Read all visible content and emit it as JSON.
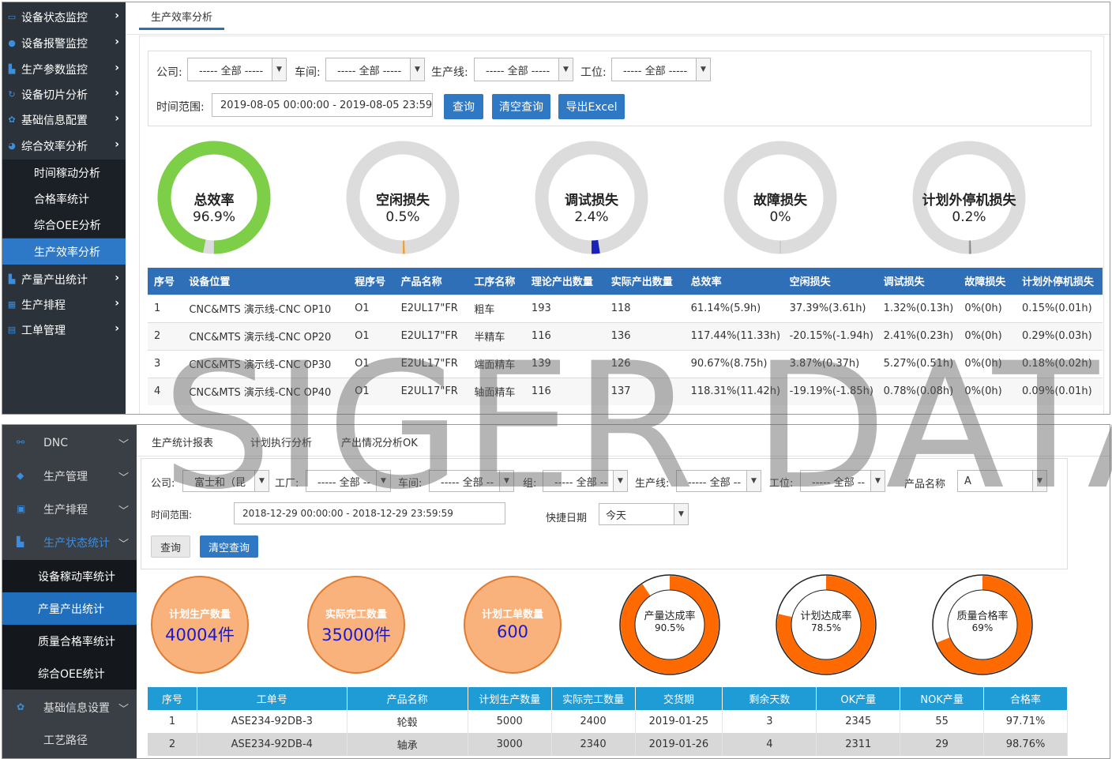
{
  "top": {
    "sidebar": {
      "items": [
        {
          "label": "设备状态监控",
          "icon": "monitor-icon"
        },
        {
          "label": "设备报警监控",
          "icon": "alarm-icon"
        },
        {
          "label": "生产参数监控",
          "icon": "chart-icon"
        },
        {
          "label": "设备切片分析",
          "icon": "refresh-icon"
        },
        {
          "label": "基础信息配置",
          "icon": "gear-icon"
        },
        {
          "label": "综合效率分析",
          "icon": "pie-icon"
        }
      ],
      "subitems": [
        "时间稼动分析",
        "合格率统计",
        "综合OEE分析",
        "生产效率分析"
      ],
      "active_sub": 3,
      "items_after": [
        {
          "label": "产量产出统计",
          "icon": "bar-chart-icon"
        },
        {
          "label": "生产排程",
          "icon": "calendar-icon"
        },
        {
          "label": "工单管理",
          "icon": "clipboard-icon"
        }
      ]
    },
    "tab": "生产效率分析",
    "filters": {
      "company_label": "公司:",
      "company_value": "----- 全部 -----",
      "workshop_label": "车间:",
      "workshop_value": "----- 全部 -----",
      "line_label": "生产线:",
      "line_value": "----- 全部 -----",
      "station_label": "工位:",
      "station_value": "----- 全部 -----",
      "time_label": "时间范围:",
      "time_value": "2019-08-05 00:00:00 - 2019-08-05 23:59:59",
      "query_btn": "查询",
      "clear_btn": "清空查询",
      "export_btn": "导出Excel"
    },
    "donuts": [
      {
        "label": "总效率",
        "value": "96.9%",
        "percent": 96.9,
        "color": "#7dcf47"
      },
      {
        "label": "空闲损失",
        "value": "0.5%",
        "percent": 0.5,
        "color": "#f0a030"
      },
      {
        "label": "调试损失",
        "value": "2.4%",
        "percent": 2.4,
        "color": "#1a23b8"
      },
      {
        "label": "故障损失",
        "value": "0%",
        "percent": 0,
        "color": "#888888"
      },
      {
        "label": "计划外停机损失",
        "value": "0.2%",
        "percent": 0.2,
        "color": "#888888"
      }
    ],
    "table": {
      "headers": [
        "序号",
        "设备位置",
        "程序号",
        "产品名称",
        "工序名称",
        "理论产出数量",
        "实际产出数量",
        "总效率",
        "空闲损失",
        "调试损失",
        "故障损失",
        "计划外停机损失"
      ],
      "rows": [
        [
          "1",
          "CNC&MTS 演示线-CNC OP10",
          "O1",
          "E2UL17\"FR",
          "粗车",
          "193",
          "118",
          "61.14%(5.9h)",
          "37.39%(3.61h)",
          "1.32%(0.13h)",
          "0%(0h)",
          "0.15%(0.01h)"
        ],
        [
          "2",
          "CNC&MTS 演示线-CNC OP20",
          "O1",
          "E2UL17\"FR",
          "半精车",
          "116",
          "136",
          "117.44%(11.33h)",
          "-20.15%(-1.94h)",
          "2.41%(0.23h)",
          "0%(0h)",
          "0.29%(0.03h)"
        ],
        [
          "3",
          "CNC&MTS 演示线-CNC OP30",
          "O1",
          "E2UL17\"FR",
          "端面精车",
          "139",
          "126",
          "90.67%(8.75h)",
          "3.87%(0.37h)",
          "5.27%(0.51h)",
          "0%(0h)",
          "0.18%(0.02h)"
        ],
        [
          "4",
          "CNC&MTS 演示线-CNC OP40",
          "O1",
          "E2UL17\"FR",
          "轴面精车",
          "116",
          "137",
          "118.31%(11.42h)",
          "-19.19%(-1.85h)",
          "0.78%(0.08h)",
          "0%(0h)",
          "0.09%(0.01h)"
        ]
      ]
    }
  },
  "bottom": {
    "sidebar": {
      "items": [
        {
          "label": "DNC",
          "icon": "dnc-icon"
        },
        {
          "label": "生产管理",
          "icon": "cube-icon"
        },
        {
          "label": "生产排程",
          "icon": "schedule-icon"
        },
        {
          "label": "生产状态统计",
          "icon": "stats-icon"
        }
      ],
      "subitems": [
        "设备稼动率统计",
        "产量产出统计",
        "质量合格率统计",
        "综合OEE统计"
      ],
      "active_sub": 1,
      "items_after": [
        {
          "label": "基础信息设置",
          "icon": "gear-icon"
        },
        {
          "label": "工艺路径",
          "icon": ""
        }
      ]
    },
    "tabs": [
      "生产统计报表",
      "计划执行分析",
      "产出情况分析OK"
    ],
    "filters": {
      "company_label": "公司:",
      "company_value": "富士和（昆",
      "factory_label": "工厂:",
      "factory_value": "----- 全部 --",
      "workshop_label": "车间:",
      "workshop_value": "----- 全部 --",
      "group_label": "组:",
      "group_value": "----- 全部 --",
      "line_label": "生产线:",
      "line_value": "----- 全部 --",
      "station_label": "工位:",
      "station_value": "----- 全部 --",
      "product_label": "产品名称",
      "product_value": "A",
      "time_label": "时间范围:",
      "time_value": "2018-12-29 00:00:00 - 2018-12-29 23:59:59",
      "quick_label": "快捷日期",
      "quick_value": "今天",
      "query_btn": "查询",
      "clear_btn": "清空查询"
    },
    "circles": [
      {
        "title": "计划生产数量",
        "value": "40004件"
      },
      {
        "title": "实际完工数量",
        "value": "35000件"
      },
      {
        "title": "计划工单数量",
        "value": "600"
      }
    ],
    "rings": [
      {
        "title": "产量达成率",
        "value": "90.5%",
        "percent": 90.5
      },
      {
        "title": "计划达成率",
        "value": "78.5%",
        "percent": 78.5
      },
      {
        "title": "质量合格率",
        "value": "69%",
        "percent": 69
      }
    ],
    "table": {
      "headers": [
        "序号",
        "工单号",
        "产品名称",
        "计划生产数量",
        "实际完工数量",
        "交货期",
        "剩余天数",
        "OK产量",
        "NOK产量",
        "合格率"
      ],
      "rows": [
        [
          "1",
          "ASE234-92DB-3",
          "轮毂",
          "5000",
          "2400",
          "2019-01-25",
          "3",
          "2345",
          "55",
          "97.71%"
        ],
        [
          "2",
          "ASE234-92DB-4",
          "轴承",
          "3000",
          "2340",
          "2019-01-26",
          "4",
          "2311",
          "29",
          "98.76%"
        ]
      ]
    }
  },
  "watermark": "SIGER DATA",
  "colors": {
    "accent": "#2f79c4",
    "table_header": "#2f6fb8",
    "orange": "#ff6a00",
    "sidebar_dark": "#2b3239"
  }
}
